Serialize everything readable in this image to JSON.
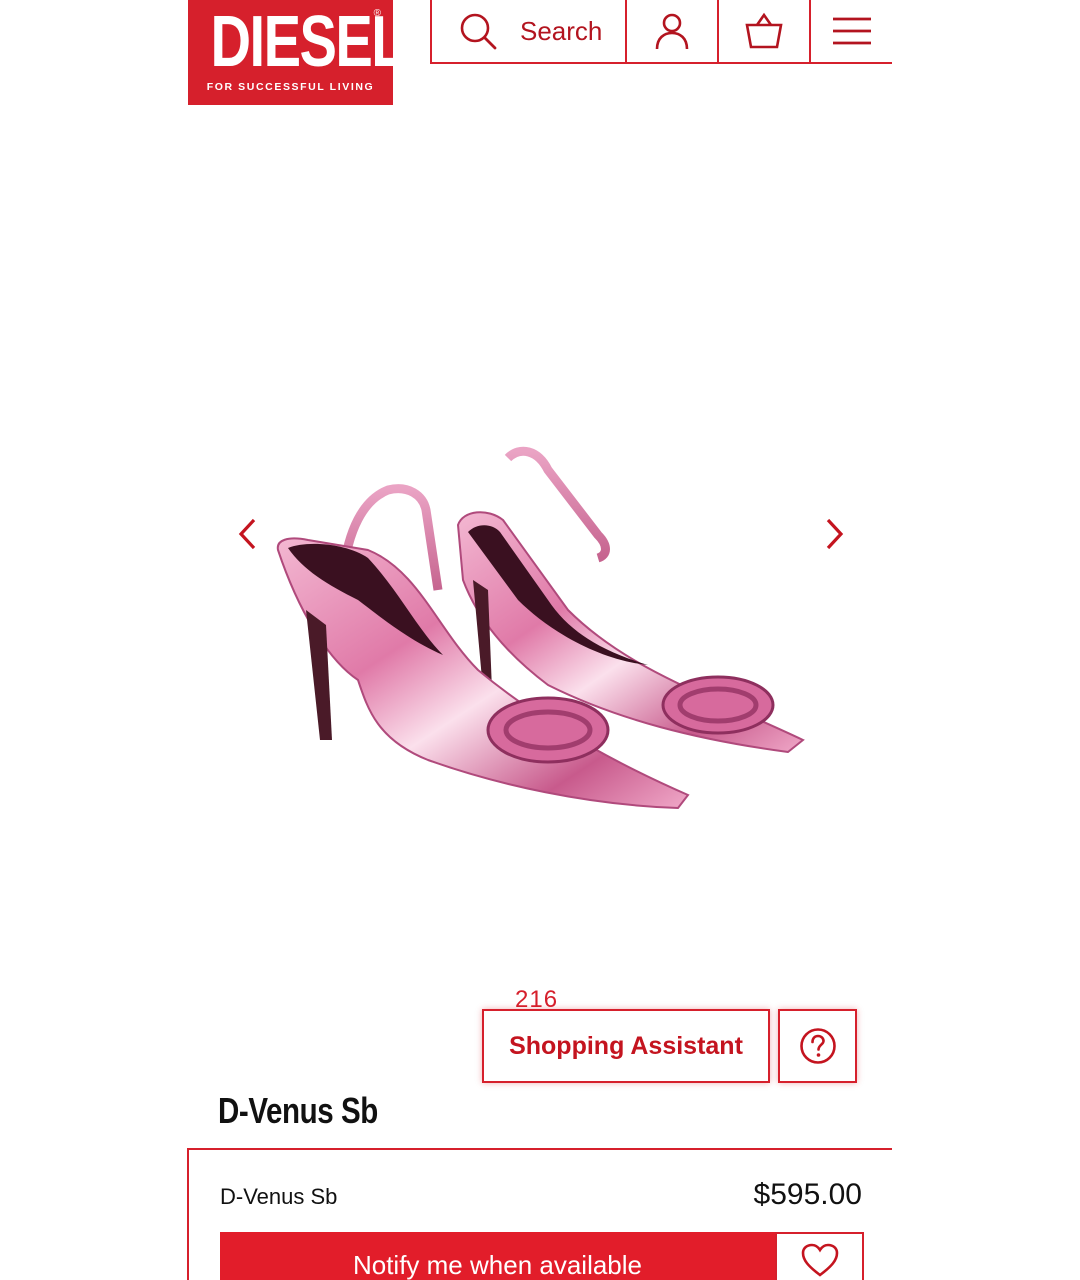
{
  "header": {
    "logo_text": "DIESEL",
    "logo_registered": "®",
    "logo_tagline": "FOR SUCCESSFUL LIVING",
    "search_label": "Search",
    "account_icon": "user-icon",
    "cart_icon": "basket-icon",
    "menu_icon": "hamburger-menu-icon"
  },
  "gallery": {
    "prev_icon": "chevron-left-icon",
    "next_icon": "chevron-right-icon",
    "image_subject": "pink metallic pointed slingback pumps"
  },
  "assistant": {
    "counter": "216",
    "button_label": "Shopping Assistant",
    "help_icon": "question-circle-icon"
  },
  "product": {
    "title": "D-Venus Sb",
    "name": "D-Venus Sb",
    "price": "$595.00",
    "notify_label": "Notify me when available",
    "wishlist_icon": "heart-icon"
  },
  "colors": {
    "brand_red": "#d6202c",
    "text_dark": "#111111",
    "background": "#ffffff"
  }
}
